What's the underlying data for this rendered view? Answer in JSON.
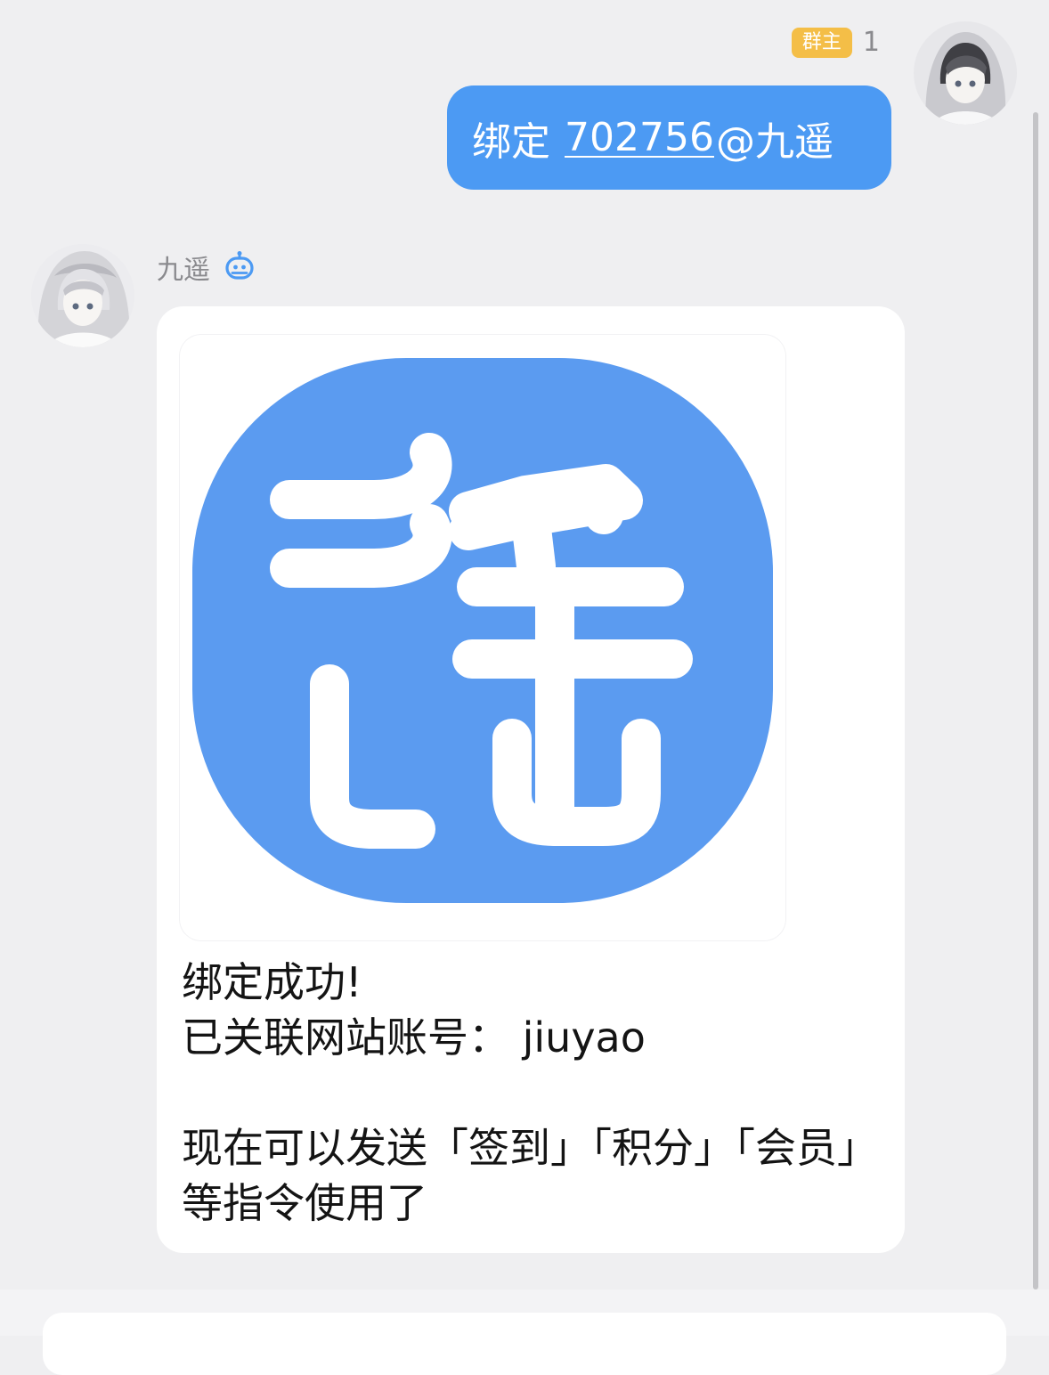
{
  "outgoing": {
    "role_badge": "群主",
    "sender_name": "1",
    "command": "绑定",
    "mention_id": "702756",
    "mention_name": "@九遥",
    "bubble_color": "#4c9af3"
  },
  "incoming": {
    "sender_name": "九遥",
    "sender_icon": "bot-icon",
    "logo_color": "#5b9bf0",
    "text_lines": [
      "绑定成功!",
      "已关联网站账号： jiuyao",
      "",
      "现在可以发送「签到」「积分」「会员」",
      "等指令使用了"
    ]
  }
}
